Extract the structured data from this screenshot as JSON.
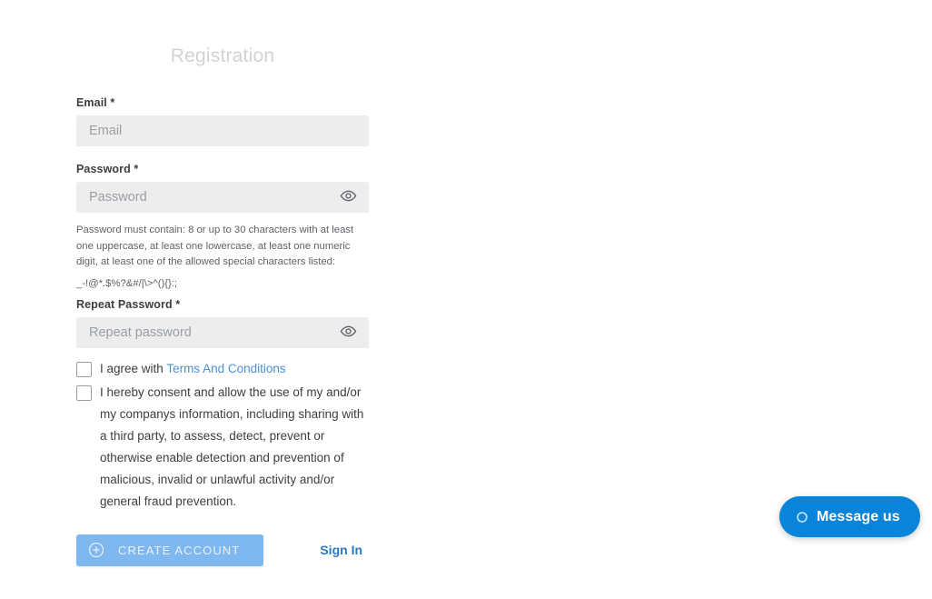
{
  "form": {
    "title": "Registration",
    "email": {
      "label": "Email *",
      "placeholder": "Email",
      "value": ""
    },
    "password": {
      "label": "Password *",
      "placeholder": "Password",
      "value": "",
      "toggle_icon": "eye-icon"
    },
    "password_hint": {
      "text": "Password must contain: 8 or up to 30 characters with at least one uppercase, at least one lowercase, at least one numeric digit, at least one of the allowed special characters listed:",
      "special_characters": "_-!@*.$%?&#/|\\>^(){}:;"
    },
    "repeat_password": {
      "label": "Repeat Password *",
      "placeholder": "Repeat password",
      "value": "",
      "toggle_icon": "eye-icon"
    },
    "terms": {
      "checked": false,
      "text_before": "I agree with",
      "link_text": "Terms And Conditions"
    },
    "consent": {
      "checked": false,
      "text": "I hereby consent and allow the use of my and/or my companys information, including sharing with a third party, to assess, detect, prevent or otherwise enable detection and prevention of malicious, invalid or unlawful activity and/or general fraud prevention."
    },
    "submit": {
      "label": "CREATE ACCOUNT",
      "icon": "plus-circle-icon",
      "disabled": true
    },
    "signin_link": "Sign In"
  },
  "chat_widget": {
    "label": "Message us",
    "icon": "chat-circle-icon"
  },
  "colors": {
    "link": "#4a90d9",
    "signin": "#2a79c4",
    "button_disabled": "#7fb8ef",
    "chat_background": "#0a84d8",
    "input_background": "#ededee",
    "title": "#d2d2d4"
  }
}
